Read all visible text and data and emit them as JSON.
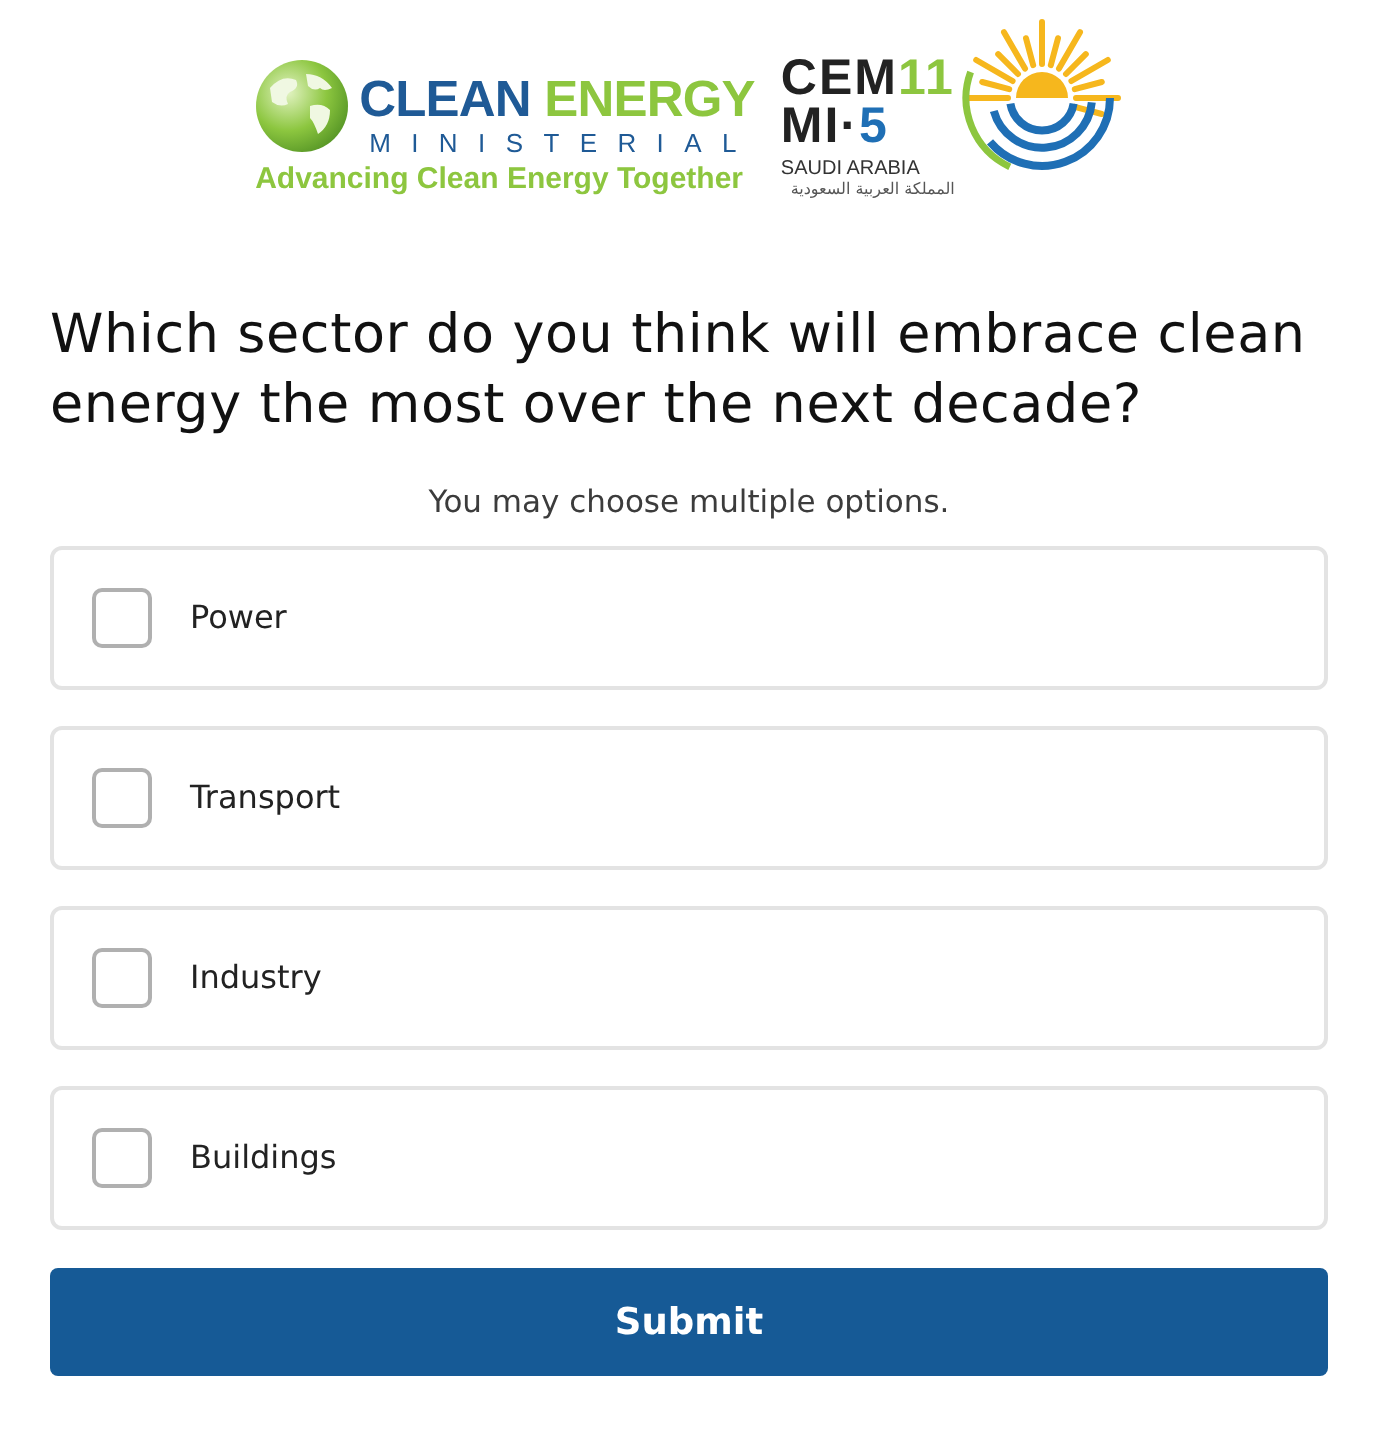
{
  "logo": {
    "wordmark": [
      "CLEAN",
      "ENERGY"
    ],
    "subtitle": "MINISTERIAL",
    "tagline": "Advancing Clean Energy Together",
    "event": [
      "CEM",
      "11"
    ],
    "meeting": [
      "MI·",
      "5"
    ],
    "host_country": "SAUDI ARABIA",
    "host_country_arabic": "المملكة العربية السعودية"
  },
  "question": "Which sector do you think will embrace clean energy the most over the next decade?",
  "instruction": "You may choose multiple options.",
  "options": [
    {
      "label": "Power",
      "checked": false
    },
    {
      "label": "Transport",
      "checked": false
    },
    {
      "label": "Industry",
      "checked": false
    },
    {
      "label": "Buildings",
      "checked": false
    }
  ],
  "submit_button": "Submit"
}
